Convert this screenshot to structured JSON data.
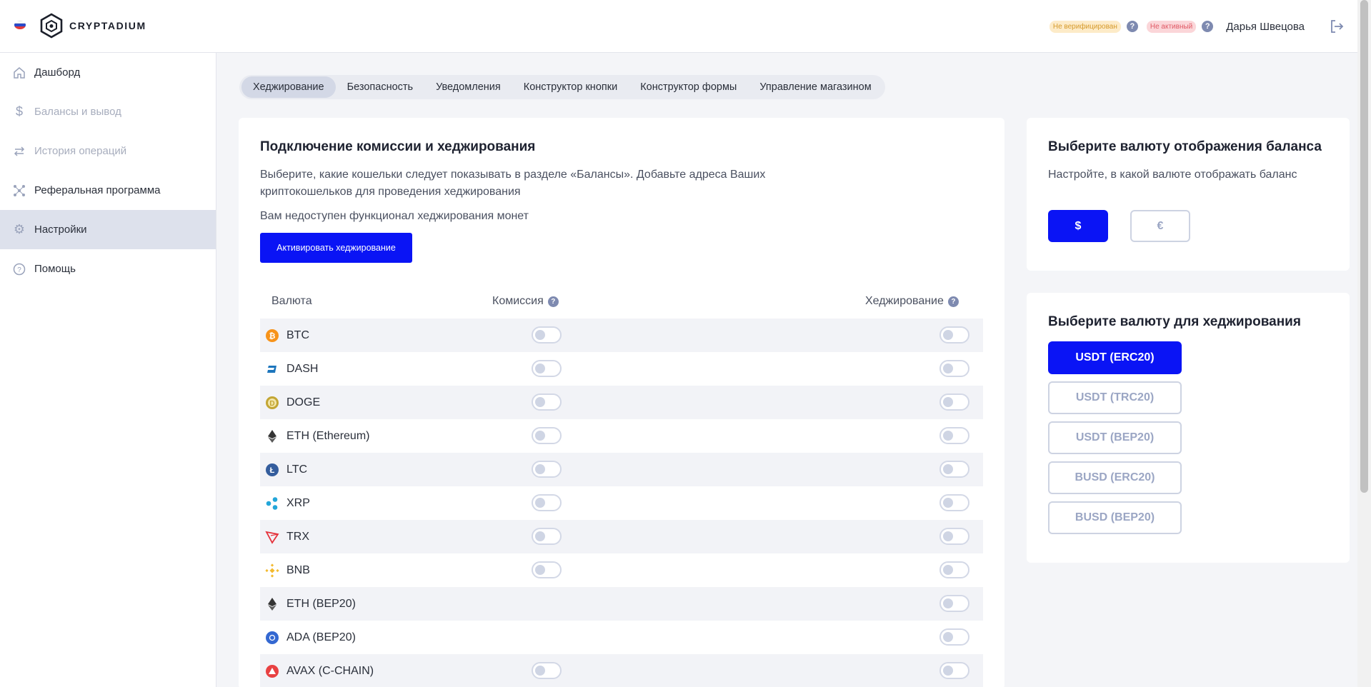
{
  "header": {
    "logo_text": "CRYPTADIUM",
    "badge_unverified": "Не верифицирован",
    "badge_inactive": "Не активный",
    "user_name": "Дарья Швецова",
    "help_glyph": "?"
  },
  "sidebar": {
    "items": [
      {
        "label": "Дашборд",
        "icon": "home-icon"
      },
      {
        "label": "Балансы и вывод",
        "icon": "dollar-icon"
      },
      {
        "label": "История операций",
        "icon": "arrows-icon"
      },
      {
        "label": "Реферальная программа",
        "icon": "network-icon"
      },
      {
        "label": "Настройки",
        "icon": "gear-icon"
      },
      {
        "label": "Помощь",
        "icon": "question-icon"
      }
    ]
  },
  "tabs": [
    "Хеджирование",
    "Безопасность",
    "Уведомления",
    "Конструктор кнопки",
    "Конструктор формы",
    "Управление магазином"
  ],
  "main": {
    "title": "Подключение комиссии и хеджирования",
    "description": "Выберите, какие кошельки следует показывать в разделе «Балансы». Добавьте адреса Ваших криптокошельков для проведения хеджирования",
    "unavailable": "Вам недоступен функционал хеджирования монет",
    "activate_button": "Активировать хеджирование",
    "columns": {
      "currency": "Валюта",
      "commission": "Комиссия",
      "hedging": "Хеджирование"
    },
    "rows": [
      {
        "name": "BTC",
        "icon": "btc-icon",
        "commission": true,
        "hedging": true
      },
      {
        "name": "DASH",
        "icon": "dash-icon",
        "commission": true,
        "hedging": true
      },
      {
        "name": "DOGE",
        "icon": "doge-icon",
        "commission": true,
        "hedging": true
      },
      {
        "name": "ETH (Ethereum)",
        "icon": "eth-icon",
        "commission": true,
        "hedging": true
      },
      {
        "name": "LTC",
        "icon": "ltc-icon",
        "commission": true,
        "hedging": true
      },
      {
        "name": "XRP",
        "icon": "xrp-icon",
        "commission": true,
        "hedging": true
      },
      {
        "name": "TRX",
        "icon": "trx-icon",
        "commission": true,
        "hedging": true
      },
      {
        "name": "BNB",
        "icon": "bnb-icon",
        "commission": true,
        "hedging": true
      },
      {
        "name": "ETH (BEP20)",
        "icon": "eth-icon",
        "commission": false,
        "hedging": true
      },
      {
        "name": "ADA (BEP20)",
        "icon": "ada-icon",
        "commission": false,
        "hedging": true
      },
      {
        "name": "AVAX (C-CHAIN)",
        "icon": "avax-icon",
        "commission": true,
        "hedging": true
      }
    ]
  },
  "balance": {
    "title": "Выберите валюту отображения баланса",
    "subtitle": "Настройте, в какой валюте отображать баланс",
    "usd": "$",
    "eur": "€"
  },
  "hedge": {
    "title": "Выберите валюту для хеджирования",
    "options": [
      "USDT (ERC20)",
      "USDT (TRC20)",
      "USDT (BEP20)",
      "BUSD (ERC20)",
      "BUSD (BEP20)"
    ],
    "selected": "USDT (ERC20)"
  },
  "colors": {
    "accent": "#0a14f5",
    "active_nav": "#dde1ec"
  }
}
